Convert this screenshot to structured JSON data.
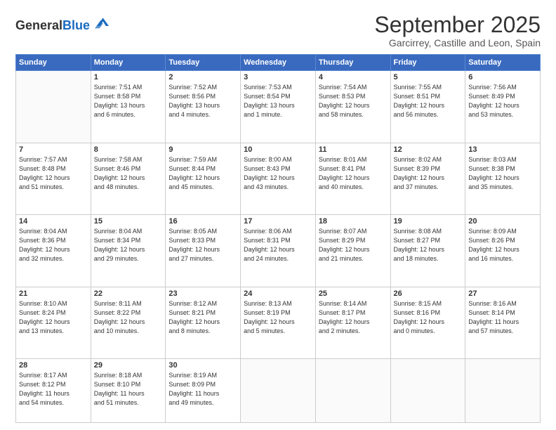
{
  "logo": {
    "general": "General",
    "blue": "Blue"
  },
  "header": {
    "month": "September 2025",
    "location": "Garcirrey, Castille and Leon, Spain"
  },
  "weekdays": [
    "Sunday",
    "Monday",
    "Tuesday",
    "Wednesday",
    "Thursday",
    "Friday",
    "Saturday"
  ],
  "weeks": [
    [
      {
        "day": "",
        "lines": []
      },
      {
        "day": "1",
        "lines": [
          "Sunrise: 7:51 AM",
          "Sunset: 8:58 PM",
          "Daylight: 13 hours",
          "and 6 minutes."
        ]
      },
      {
        "day": "2",
        "lines": [
          "Sunrise: 7:52 AM",
          "Sunset: 8:56 PM",
          "Daylight: 13 hours",
          "and 4 minutes."
        ]
      },
      {
        "day": "3",
        "lines": [
          "Sunrise: 7:53 AM",
          "Sunset: 8:54 PM",
          "Daylight: 13 hours",
          "and 1 minute."
        ]
      },
      {
        "day": "4",
        "lines": [
          "Sunrise: 7:54 AM",
          "Sunset: 8:53 PM",
          "Daylight: 12 hours",
          "and 58 minutes."
        ]
      },
      {
        "day": "5",
        "lines": [
          "Sunrise: 7:55 AM",
          "Sunset: 8:51 PM",
          "Daylight: 12 hours",
          "and 56 minutes."
        ]
      },
      {
        "day": "6",
        "lines": [
          "Sunrise: 7:56 AM",
          "Sunset: 8:49 PM",
          "Daylight: 12 hours",
          "and 53 minutes."
        ]
      }
    ],
    [
      {
        "day": "7",
        "lines": [
          "Sunrise: 7:57 AM",
          "Sunset: 8:48 PM",
          "Daylight: 12 hours",
          "and 51 minutes."
        ]
      },
      {
        "day": "8",
        "lines": [
          "Sunrise: 7:58 AM",
          "Sunset: 8:46 PM",
          "Daylight: 12 hours",
          "and 48 minutes."
        ]
      },
      {
        "day": "9",
        "lines": [
          "Sunrise: 7:59 AM",
          "Sunset: 8:44 PM",
          "Daylight: 12 hours",
          "and 45 minutes."
        ]
      },
      {
        "day": "10",
        "lines": [
          "Sunrise: 8:00 AM",
          "Sunset: 8:43 PM",
          "Daylight: 12 hours",
          "and 43 minutes."
        ]
      },
      {
        "day": "11",
        "lines": [
          "Sunrise: 8:01 AM",
          "Sunset: 8:41 PM",
          "Daylight: 12 hours",
          "and 40 minutes."
        ]
      },
      {
        "day": "12",
        "lines": [
          "Sunrise: 8:02 AM",
          "Sunset: 8:39 PM",
          "Daylight: 12 hours",
          "and 37 minutes."
        ]
      },
      {
        "day": "13",
        "lines": [
          "Sunrise: 8:03 AM",
          "Sunset: 8:38 PM",
          "Daylight: 12 hours",
          "and 35 minutes."
        ]
      }
    ],
    [
      {
        "day": "14",
        "lines": [
          "Sunrise: 8:04 AM",
          "Sunset: 8:36 PM",
          "Daylight: 12 hours",
          "and 32 minutes."
        ]
      },
      {
        "day": "15",
        "lines": [
          "Sunrise: 8:04 AM",
          "Sunset: 8:34 PM",
          "Daylight: 12 hours",
          "and 29 minutes."
        ]
      },
      {
        "day": "16",
        "lines": [
          "Sunrise: 8:05 AM",
          "Sunset: 8:33 PM",
          "Daylight: 12 hours",
          "and 27 minutes."
        ]
      },
      {
        "day": "17",
        "lines": [
          "Sunrise: 8:06 AM",
          "Sunset: 8:31 PM",
          "Daylight: 12 hours",
          "and 24 minutes."
        ]
      },
      {
        "day": "18",
        "lines": [
          "Sunrise: 8:07 AM",
          "Sunset: 8:29 PM",
          "Daylight: 12 hours",
          "and 21 minutes."
        ]
      },
      {
        "day": "19",
        "lines": [
          "Sunrise: 8:08 AM",
          "Sunset: 8:27 PM",
          "Daylight: 12 hours",
          "and 18 minutes."
        ]
      },
      {
        "day": "20",
        "lines": [
          "Sunrise: 8:09 AM",
          "Sunset: 8:26 PM",
          "Daylight: 12 hours",
          "and 16 minutes."
        ]
      }
    ],
    [
      {
        "day": "21",
        "lines": [
          "Sunrise: 8:10 AM",
          "Sunset: 8:24 PM",
          "Daylight: 12 hours",
          "and 13 minutes."
        ]
      },
      {
        "day": "22",
        "lines": [
          "Sunrise: 8:11 AM",
          "Sunset: 8:22 PM",
          "Daylight: 12 hours",
          "and 10 minutes."
        ]
      },
      {
        "day": "23",
        "lines": [
          "Sunrise: 8:12 AM",
          "Sunset: 8:21 PM",
          "Daylight: 12 hours",
          "and 8 minutes."
        ]
      },
      {
        "day": "24",
        "lines": [
          "Sunrise: 8:13 AM",
          "Sunset: 8:19 PM",
          "Daylight: 12 hours",
          "and 5 minutes."
        ]
      },
      {
        "day": "25",
        "lines": [
          "Sunrise: 8:14 AM",
          "Sunset: 8:17 PM",
          "Daylight: 12 hours",
          "and 2 minutes."
        ]
      },
      {
        "day": "26",
        "lines": [
          "Sunrise: 8:15 AM",
          "Sunset: 8:16 PM",
          "Daylight: 12 hours",
          "and 0 minutes."
        ]
      },
      {
        "day": "27",
        "lines": [
          "Sunrise: 8:16 AM",
          "Sunset: 8:14 PM",
          "Daylight: 11 hours",
          "and 57 minutes."
        ]
      }
    ],
    [
      {
        "day": "28",
        "lines": [
          "Sunrise: 8:17 AM",
          "Sunset: 8:12 PM",
          "Daylight: 11 hours",
          "and 54 minutes."
        ]
      },
      {
        "day": "29",
        "lines": [
          "Sunrise: 8:18 AM",
          "Sunset: 8:10 PM",
          "Daylight: 11 hours",
          "and 51 minutes."
        ]
      },
      {
        "day": "30",
        "lines": [
          "Sunrise: 8:19 AM",
          "Sunset: 8:09 PM",
          "Daylight: 11 hours",
          "and 49 minutes."
        ]
      },
      {
        "day": "",
        "lines": []
      },
      {
        "day": "",
        "lines": []
      },
      {
        "day": "",
        "lines": []
      },
      {
        "day": "",
        "lines": []
      }
    ]
  ]
}
